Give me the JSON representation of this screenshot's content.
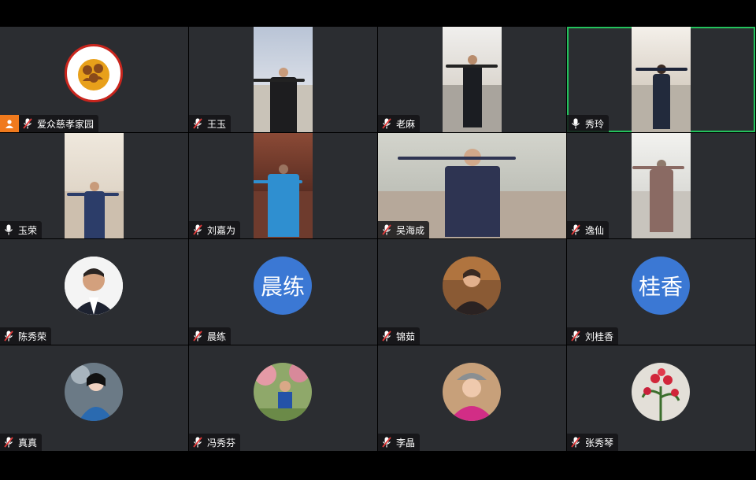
{
  "accent": "#23c25c",
  "host_badge_color": "#f07a1d",
  "participants": [
    {
      "name": "爱众慈孝家园",
      "mic": "muted",
      "host": true,
      "tile": "logo",
      "logo_text": "爱众慈孝家园"
    },
    {
      "name": "王玉",
      "mic": "muted",
      "tile": "video"
    },
    {
      "name": "老麻",
      "mic": "muted",
      "tile": "video"
    },
    {
      "name": "秀玲",
      "mic": "on",
      "tile": "video",
      "active": true
    },
    {
      "name": "玉荣",
      "mic": "on",
      "tile": "video"
    },
    {
      "name": "刘嘉为",
      "mic": "muted",
      "tile": "video"
    },
    {
      "name": "吴海成",
      "mic": "muted",
      "tile": "video-wide"
    },
    {
      "name": "逸仙",
      "mic": "muted",
      "tile": "video"
    },
    {
      "name": "陈秀荣",
      "mic": "muted",
      "tile": "photo"
    },
    {
      "name": "晨练",
      "mic": "muted",
      "tile": "initials",
      "initials": "晨练"
    },
    {
      "name": "锦茹",
      "mic": "muted",
      "tile": "photo"
    },
    {
      "name": "刘桂香",
      "mic": "muted",
      "tile": "initials",
      "initials": "桂香"
    },
    {
      "name": "真真",
      "mic": "muted",
      "tile": "photo"
    },
    {
      "name": "冯秀芬",
      "mic": "muted",
      "tile": "photo"
    },
    {
      "name": "李晶",
      "mic": "muted",
      "tile": "photo"
    },
    {
      "name": "张秀琴",
      "mic": "muted",
      "tile": "photo"
    }
  ]
}
